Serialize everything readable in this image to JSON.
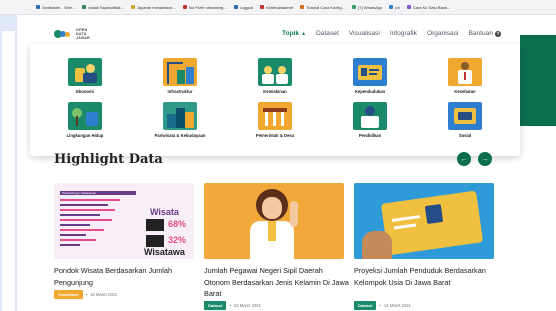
{
  "bookmarks": [
    {
      "label": "Gratisfoler - Sele...",
      "color": "#2b6cb0"
    },
    {
      "label": "Install Sspirodfllak...",
      "color": "#2f855a"
    },
    {
      "label": "Jayaran mekanistok...",
      "color": "#d69e2e"
    },
    {
      "label": "No Flizfe streaming...",
      "color": "#c53030"
    },
    {
      "label": "Loggod",
      "color": "#2b6cb0"
    },
    {
      "label": "Kbhfeuladarnet",
      "color": "#c53030"
    },
    {
      "label": "Tutorial Cara Konfig...",
      "color": "#dd6b20"
    },
    {
      "label": "(7) WhatsApp",
      "color": "#38a169"
    },
    {
      "label": "ph",
      "color": "#3182ce"
    },
    {
      "label": "Cara Ko Satu Bank...",
      "color": "#805ad5"
    }
  ],
  "logo": {
    "line1": "OPEN",
    "line2": "DATA",
    "line3": "JABAR"
  },
  "nav": {
    "topik": "Topik",
    "dataset": "Dataset",
    "visualisasi": "Visualisasi",
    "infografik": "Infografik",
    "organisasi": "Organisasi",
    "bantuan": "Bantuan",
    "help_symbol": "?"
  },
  "topics": [
    {
      "label": "Ekonomi",
      "icon": "economy-icon",
      "bg": "#1b8a6b"
    },
    {
      "label": "Infrastruktur",
      "icon": "infrastructure-icon",
      "bg": "#f0a830"
    },
    {
      "label": "Kemiskinan",
      "icon": "poverty-icon",
      "bg": "#1b8a6b"
    },
    {
      "label": "Kependudukan",
      "icon": "population-icon",
      "bg": "#2f7fd0"
    },
    {
      "label": "Kesehatan",
      "icon": "health-icon",
      "bg": "#f0a830"
    },
    {
      "label": "Lingkungan Hidup",
      "icon": "environment-icon",
      "bg": "#1b8a6b"
    },
    {
      "label": "Pariwisata & Kebudayaan",
      "icon": "tourism-icon",
      "bg": "#2f9a8a"
    },
    {
      "label": "Pemerintah & Desa",
      "icon": "government-icon",
      "bg": "#f0a830"
    },
    {
      "label": "Pendidikan",
      "icon": "education-icon",
      "bg": "#1b8a6b"
    },
    {
      "label": "Sosial",
      "icon": "social-icon",
      "bg": "#2f7fd0"
    }
  ],
  "highlight": {
    "title": "Highlight Data",
    "prev": "←",
    "next": "→"
  },
  "cards": [
    {
      "title": "Pondok Wisata Berdasarkan Jumlah Pengunjung",
      "badge": "Visualisasi",
      "badge_color": "#f0a830",
      "date": "16 Maret 2021",
      "img_text_wisata": "Wisata",
      "img_pct1": "68%",
      "img_pct2": "32%",
      "img_text_wisatawa": "Wisatawa",
      "img_caption": "Perbandingan Wisatawan"
    },
    {
      "title": "Jumlah Pegawai Negeri Sipil Daerah Otonom Berdasarkan Jenis Kelamin Di Jawa Barat",
      "badge": "Dataset",
      "badge_color": "#1b8a6b",
      "date": "22 Maret 2021"
    },
    {
      "title": "Proyeksi Jumlah Penduduk Berdasarkan Kelompok Usia Di Jawa Barat",
      "badge": "Dataset",
      "badge_color": "#1b8a6b",
      "date": "16 Maret 2021"
    }
  ]
}
